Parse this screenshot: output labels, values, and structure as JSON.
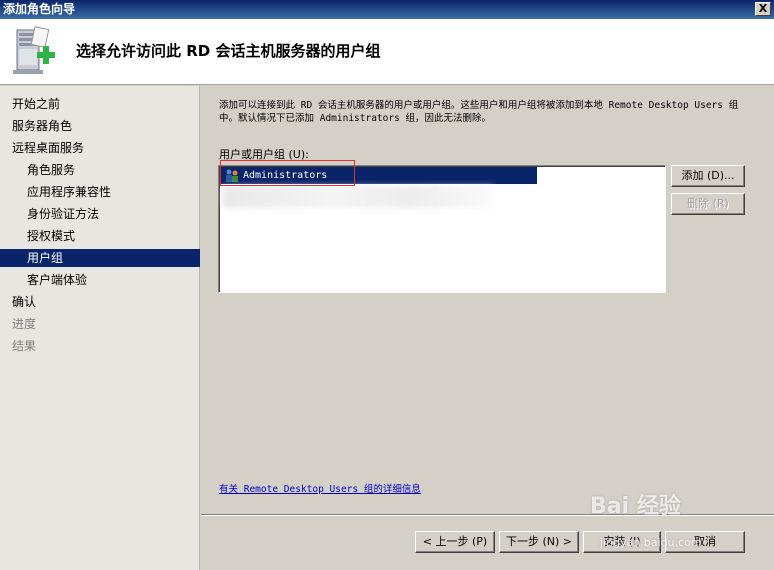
{
  "window": {
    "title": "添加角色向导",
    "close_glyph": "X"
  },
  "header": {
    "title": "选择允许访问此 RD 会话主机服务器的用户组",
    "icon": "server-add-icon"
  },
  "sidebar": {
    "items": [
      {
        "label": "开始之前",
        "level": 0,
        "state": "normal"
      },
      {
        "label": "服务器角色",
        "level": 0,
        "state": "normal"
      },
      {
        "label": "远程桌面服务",
        "level": 0,
        "state": "normal"
      },
      {
        "label": "角色服务",
        "level": 1,
        "state": "normal"
      },
      {
        "label": "应用程序兼容性",
        "level": 1,
        "state": "normal"
      },
      {
        "label": "身份验证方法",
        "level": 1,
        "state": "normal"
      },
      {
        "label": "授权模式",
        "level": 1,
        "state": "normal"
      },
      {
        "label": "用户组",
        "level": 1,
        "state": "selected"
      },
      {
        "label": "客户端体验",
        "level": 1,
        "state": "normal"
      },
      {
        "label": "确认",
        "level": 0,
        "state": "normal"
      },
      {
        "label": "进度",
        "level": 0,
        "state": "disabled"
      },
      {
        "label": "结果",
        "level": 0,
        "state": "disabled"
      }
    ]
  },
  "main": {
    "description": "添加可以连接到此 RD 会话主机服务器的用户或用户组。这些用户和用户组将被添加到本地 Remote Desktop Users 组中。默认情况下已添加 Administrators 组，因此无法删除。",
    "list_label": "用户或用户组 (U):",
    "list_items": [
      {
        "label": "Administrators",
        "icon": "user-group-icon",
        "selected": true
      }
    ],
    "add_button": "添加 (D)...",
    "remove_button": "删除 (R)",
    "more_info_link": "有关 Remote Desktop Users 组的详细信息"
  },
  "footer": {
    "prev_button": "< 上一步 (P)",
    "next_button": "下一步 (N) >",
    "install_button": "安装 (I)",
    "cancel_button": "取消"
  },
  "watermark": {
    "text": "Bai 经验",
    "sub": "jingyan.baidu.com"
  },
  "colors": {
    "title_bar": "#0a246a",
    "selection": "#0a246a",
    "link": "#0000cc",
    "annotation_box": "#e03030"
  }
}
